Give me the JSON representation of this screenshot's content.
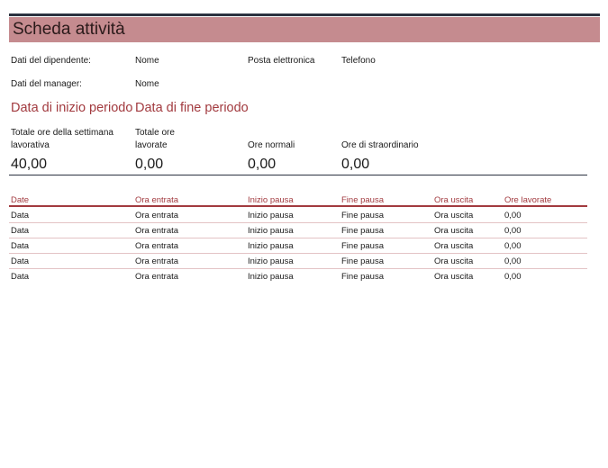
{
  "title": "Scheda attività",
  "employee": {
    "label": "Dati del dipendente:",
    "name": "Nome",
    "email": "Posta elettronica",
    "phone": "Telefono"
  },
  "manager": {
    "label": "Dati del manager:",
    "name": "Nome"
  },
  "period": {
    "start": "Data di inizio periodo",
    "end": "Data di fine periodo"
  },
  "totals": {
    "week_label": "Totale ore della settimana lavorativa",
    "worked_label": "Totale ore lavorate",
    "regular_label": "Ore normali",
    "overtime_label": "Ore di straordinario",
    "week_value": "40,00",
    "worked_value": "0,00",
    "regular_value": "0,00",
    "overtime_value": "0,00"
  },
  "table": {
    "headers": [
      "Date",
      "Ora entrata",
      "Inizio pausa",
      "Fine pausa",
      "Ora uscita",
      "Ore lavorate"
    ],
    "rows": [
      [
        "Data",
        "Ora entrata",
        "Inizio pausa",
        "Fine pausa",
        "Ora uscita",
        "0,00"
      ],
      [
        "Data",
        "Ora entrata",
        "Inizio pausa",
        "Fine pausa",
        "Ora uscita",
        "0,00"
      ],
      [
        "Data",
        "Ora entrata",
        "Inizio pausa",
        "Fine pausa",
        "Ora uscita",
        "0,00"
      ],
      [
        "Data",
        "Ora entrata",
        "Inizio pausa",
        "Fine pausa",
        "Ora uscita",
        "0,00"
      ],
      [
        "Data",
        "Ora entrata",
        "Inizio pausa",
        "Fine pausa",
        "Ora uscita",
        "0,00"
      ]
    ]
  },
  "colors": {
    "accent": "#a23a3f",
    "title_band": "#c58b8f",
    "rule_dark": "#2b3240",
    "row_line": "#e3c3c5"
  }
}
